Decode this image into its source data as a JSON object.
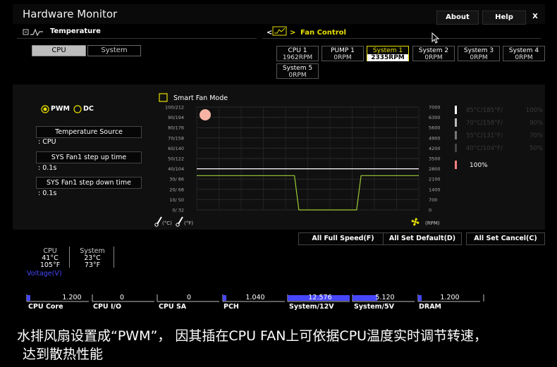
{
  "app": {
    "title": "Hardware Monitor"
  },
  "header": {
    "about_label": "About",
    "help_label": "Help",
    "close_label": "X"
  },
  "temperature": {
    "section_label": "Temperature",
    "toggle_cpu": "CPU",
    "toggle_system": "System",
    "mode_pwm": "PWM",
    "mode_dc": "DC",
    "temp_source_label": "Temperature Source",
    "temp_source_value": ": CPU",
    "step_up_label": "SYS Fan1 step up time",
    "step_up_value": ": 0.1s",
    "step_down_label": "SYS Fan1 step down time",
    "step_down_value": ": 0.1s"
  },
  "fan_control": {
    "section_label": "Fan Control",
    "back_arrow": "<",
    "fwd_arrow": ">",
    "fans": [
      {
        "name": "CPU 1",
        "rpm": "1962RPM",
        "active": false
      },
      {
        "name": "PUMP 1",
        "rpm": "0RPM",
        "active": false
      },
      {
        "name": "System 1",
        "rpm": "2335RPM",
        "active": true
      },
      {
        "name": "System 2",
        "rpm": "0RPM",
        "active": false
      },
      {
        "name": "System 3",
        "rpm": "0RPM",
        "active": false
      },
      {
        "name": "System 4",
        "rpm": "0RPM",
        "active": false
      },
      {
        "name": "System 5",
        "rpm": "0RPM",
        "active": false
      }
    ]
  },
  "chart": {
    "smart_fan_label": "Smart Fan Mode",
    "y_left_ticks": [
      "100/212",
      "90/194",
      "80/176",
      "70/158",
      "60/140",
      "50/122",
      "40/104",
      "30/ 86",
      "20/ 68",
      "10/ 50",
      "0/ 32"
    ],
    "y_right_ticks": [
      "7000",
      "6300",
      "5600",
      "4900",
      "4200",
      "3500",
      "2800",
      "2100",
      "1400",
      "700",
      "0"
    ],
    "unit_c": "(°C)",
    "unit_f": "(°F)",
    "unit_rpm": "(RPM)",
    "legend": [
      {
        "label": "85°C/185°F/",
        "pct": "100%",
        "color": "#ffffff"
      },
      {
        "label": "70°C/158°F/",
        "pct": "90%",
        "color": "#bbbbbb"
      },
      {
        "label": "55°C/131°F/",
        "pct": "70%",
        "color": "#777777"
      },
      {
        "label": "40°C/104°F/",
        "pct": "50%",
        "color": "#444444"
      }
    ],
    "current_pct": "100%",
    "current_color": "#ff8080"
  },
  "chart_data": {
    "type": "line",
    "title": "",
    "xlabel": "",
    "ylabel": "",
    "series": [
      {
        "values": [
          40,
          40,
          40,
          40,
          40,
          40,
          40,
          40,
          40,
          40,
          40,
          40,
          40,
          40,
          40,
          40,
          40,
          40,
          40,
          40,
          40,
          40,
          40,
          40,
          40,
          40,
          40,
          40,
          40,
          40,
          40,
          40,
          40,
          40,
          40,
          40,
          40,
          40,
          40,
          40,
          40,
          40,
          40,
          40,
          40,
          40,
          40,
          40,
          40,
          40,
          40
        ]
      },
      {
        "values": [
          2335,
          2335,
          2335,
          2335,
          2335,
          2335,
          2335,
          2335,
          2335,
          2335,
          2335,
          2335,
          2335,
          2335,
          2335,
          2335,
          2335,
          2335,
          2335,
          2335,
          2335,
          2335,
          2335,
          0,
          0,
          0,
          0,
          0,
          0,
          0,
          0,
          0,
          0,
          0,
          0,
          0,
          0,
          2335,
          2335,
          2335,
          2335,
          2335,
          2335,
          2335,
          2335,
          2335,
          2335,
          2335,
          2335,
          2335,
          2335
        ]
      }
    ],
    "ylim_left": [
      0,
      100
    ],
    "ylim_right": [
      0,
      7000
    ],
    "grid": true
  },
  "actions": {
    "all_full_speed": "All Full Speed(F)",
    "all_set_default": "All Set Default(D)",
    "all_set_cancel": "All Set Cancel(C)"
  },
  "temps": [
    {
      "name": "CPU",
      "c": "41°C",
      "f": "105°F"
    },
    {
      "name": "System",
      "c": "23°C",
      "f": "73°F"
    }
  ],
  "voltage": {
    "label": "Voltage(V)",
    "items": [
      {
        "name": "CPU Core",
        "value": "1.200",
        "fill": 0.05
      },
      {
        "name": "CPU I/O",
        "value": "0",
        "fill": 0
      },
      {
        "name": "CPU SA",
        "value": "0",
        "fill": 0
      },
      {
        "name": "PCH",
        "value": "1.040",
        "fill": 0.05
      },
      {
        "name": "System/12V",
        "value": "12.576",
        "fill": 1.0
      },
      {
        "name": "System/5V",
        "value": "5.120",
        "fill": 0.4
      },
      {
        "name": "DRAM",
        "value": "1.200",
        "fill": 0.05
      }
    ]
  },
  "caption": {
    "line1": "水排风扇设置成“PWM”， 因其插在CPU FAN上可依据CPU温度实时调节转速，",
    "line2": "达到散热性能"
  },
  "colors": {
    "accent_yellow": "#e8e000",
    "voltage_blue": "#4646ff",
    "fan_curve": "#9ccc35",
    "temp_line": "#ffffff"
  }
}
